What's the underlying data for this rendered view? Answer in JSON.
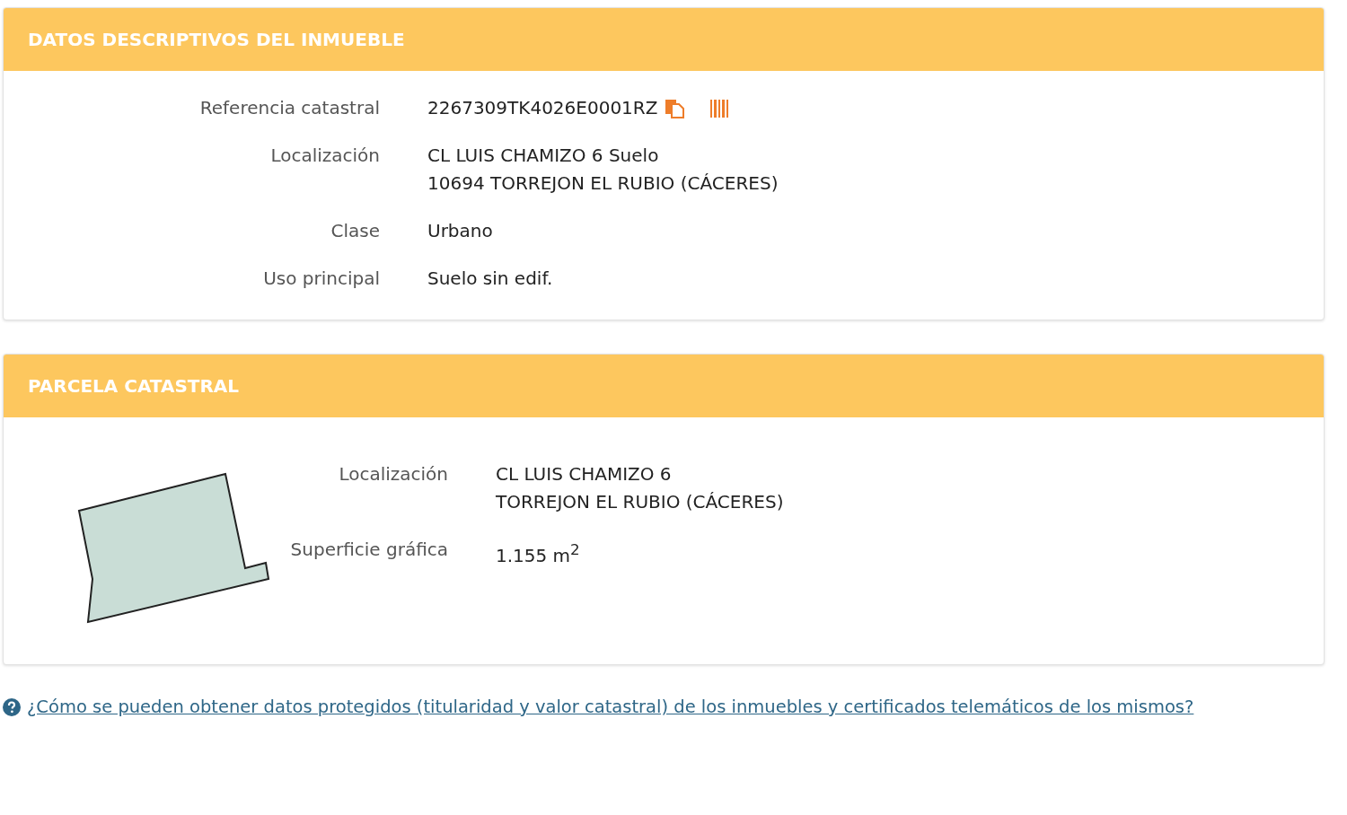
{
  "panels": [
    {
      "title": "DATOS DESCRIPTIVOS DEL INMUEBLE",
      "kind": "fields",
      "rows": [
        {
          "label": "Referencia catastral",
          "lines": [
            "2267309TK4026E0001RZ"
          ],
          "kind": "reference"
        },
        {
          "label": "Localización",
          "lines": [
            "CL LUIS CHAMIZO 6 Suelo",
            "10694 TORREJON EL RUBIO (CÁCERES)"
          ],
          "kind": "text"
        },
        {
          "label": "Clase",
          "lines": [
            "Urbano"
          ],
          "kind": "text"
        },
        {
          "label": "Uso principal",
          "lines": [
            "Suelo sin edif."
          ],
          "kind": "text"
        }
      ]
    },
    {
      "title": "PARCELA CATASTRAL",
      "kind": "parcel",
      "rows": [
        {
          "label": "Localización",
          "lines": [
            "CL LUIS CHAMIZO 6",
            "TORREJON EL RUBIO (CÁCERES)"
          ],
          "kind": "text"
        },
        {
          "label": "Superficie gráfica",
          "lines": [
            "1.155 m$^{2}$"
          ],
          "kind": "text"
        }
      ]
    }
  ],
  "help_link": "¿Cómo se pueden obtener datos protegidos (titularidad y valor catastral) de los inmuebles y certificados telemáticos de los mismos?"
}
